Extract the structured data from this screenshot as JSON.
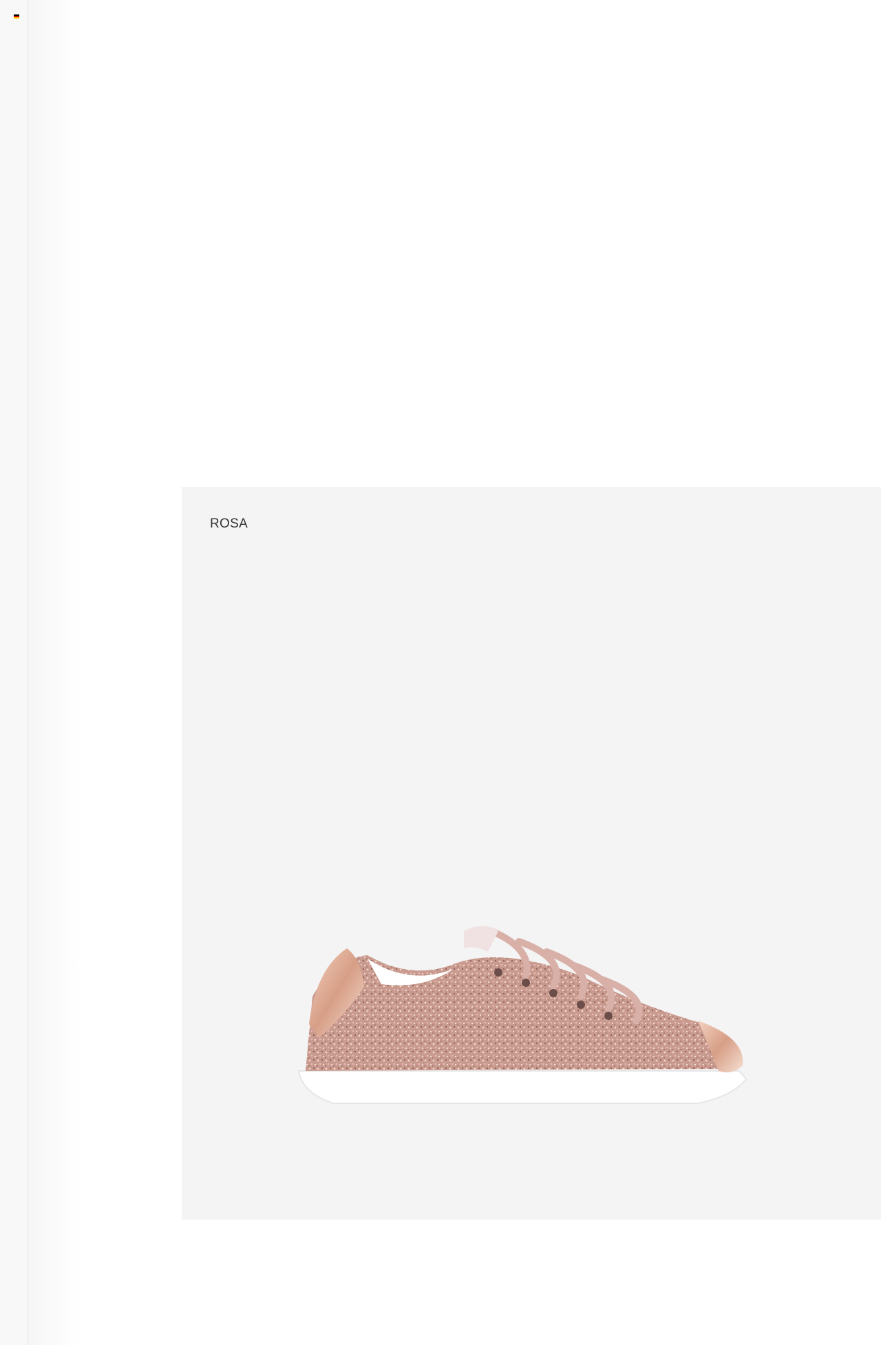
{
  "header": {
    "language_flag": "de-flag-icon",
    "flag_colors": [
      "#000000",
      "#dd0000",
      "#ffce00"
    ]
  },
  "product": {
    "color_label": "ROSA",
    "image_icon": "sneaker-glitter-image"
  },
  "colors": {
    "card_background": "#f4f4f4",
    "shoe_glitter": "#c99a8e",
    "shoe_metallic": "#e3b29a",
    "sole": "#ffffff"
  }
}
